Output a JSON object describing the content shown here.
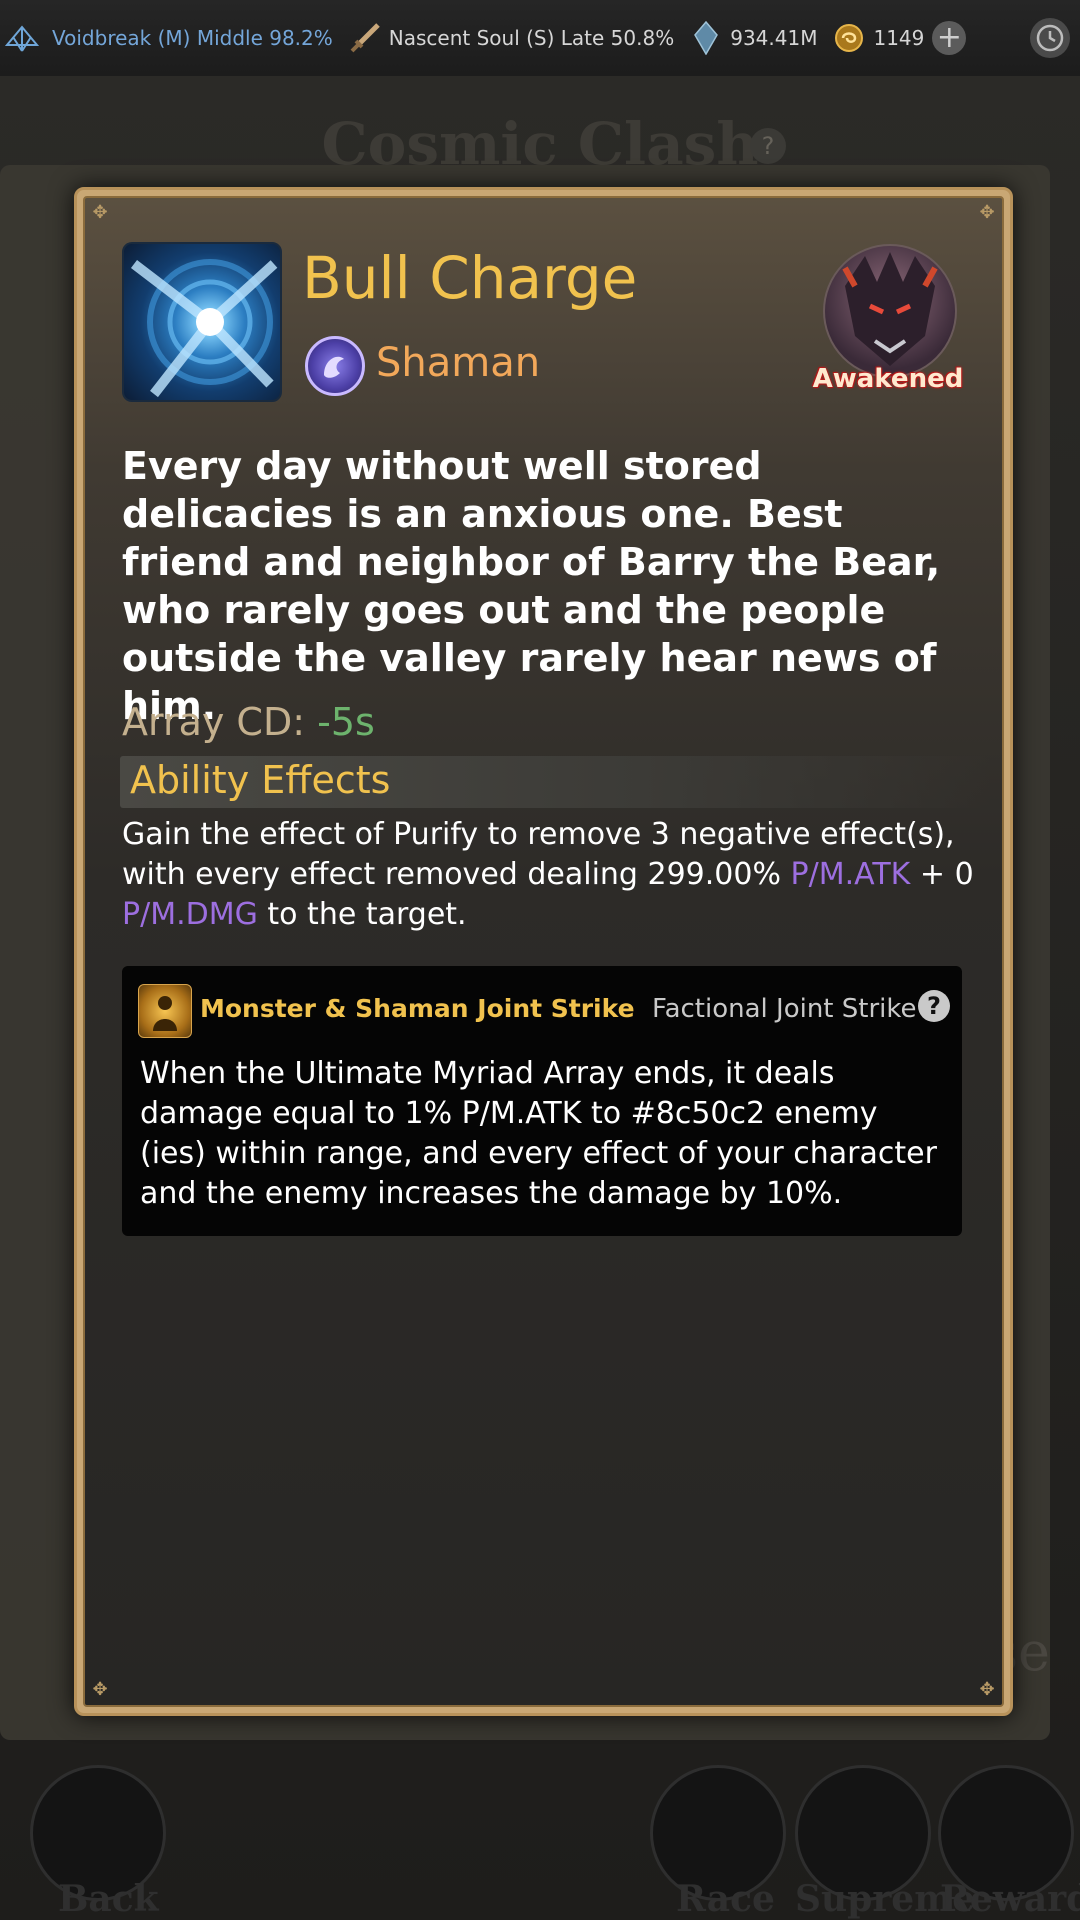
{
  "status_bar": {
    "realm_left": "Voidbreak (M) Middle 98.2%",
    "realm_right": "Nascent Soul (S) Late 50.8%",
    "spirit_stones": "934.41M",
    "currency": "1149"
  },
  "background": {
    "title": "Cosmic Clash",
    "close_partial": "se",
    "bottom_labels": [
      "Back",
      "Race",
      "Supreme",
      "Rewards"
    ]
  },
  "skill": {
    "name": "Bull Charge",
    "class": "Shaman",
    "badge": "Awakened",
    "description": "Every day without well stored delicacies is an anxious one. Best friend and neighbor of Barry the Bear, who rarely goes out and the people outside the valley rarely hear news of him.",
    "cd_label": "Array CD:",
    "cd_value": "-5s",
    "effects_header": "Ability Effects",
    "effect_part1": "Gain the effect of Purify to remove 3 negative effect(s), with every effect removed dealing 299.00%",
    "effect_stat1": "P/M.ATK",
    "effect_part2": "+ 0",
    "effect_stat2": "P/M.DMG",
    "effect_part3": "to the target."
  },
  "joint_strike": {
    "title": "Monster & Shaman Joint Strike",
    "type": "Factional Joint Strike",
    "help": "?",
    "text": "When the Ultimate Myriad Array ends, it deals damage equal to 1% P/M.ATK to #8c50c2 enemy (ies) within range, and every effect of your character and the enemy increases the damage by 10%."
  }
}
